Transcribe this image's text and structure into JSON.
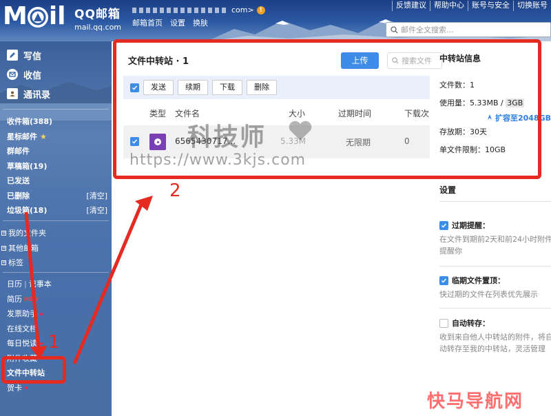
{
  "header": {
    "logo_main": "M",
    "logo_tail": "il",
    "logo_cn": "QQ邮箱",
    "logo_url": "mail.qq.com",
    "account_suffix": "com>",
    "warn_icon": "!",
    "nav": [
      "邮箱首页",
      "设置",
      "换肤"
    ],
    "top_links": [
      "反馈建议",
      "帮助中心",
      "账号与安全",
      "切换账号"
    ],
    "search_placeholder": "邮件全文搜索..."
  },
  "sidebar": {
    "quick": [
      {
        "label": "写信",
        "icon": "pen-icon"
      },
      {
        "label": "收信",
        "icon": "inbox-icon"
      },
      {
        "label": "通讯录",
        "icon": "contacts-icon"
      }
    ],
    "folders": [
      {
        "label": "收件箱(388)",
        "right": ""
      },
      {
        "label": "星标邮件",
        "right": "",
        "star": "★"
      },
      {
        "label": "群邮件",
        "right": ""
      },
      {
        "label": "草稿箱(19)",
        "right": ""
      },
      {
        "label": "已发送",
        "right": ""
      },
      {
        "label": "已删除",
        "right": "[清空]"
      },
      {
        "label": "垃圾箱(18)",
        "right": "[清空]"
      }
    ],
    "groups": [
      "我的文件夹",
      "其他邮箱",
      "标签"
    ],
    "apps": [
      {
        "label": "日历",
        "extra": "记事本"
      },
      {
        "label": "简历",
        "badge": "NEW"
      },
      {
        "label": "发票助手"
      },
      {
        "label": "在线文档"
      },
      {
        "label": "每日悦读"
      },
      {
        "label": "附件收藏"
      },
      {
        "label": "文件中转站"
      },
      {
        "label": "贺卡"
      }
    ]
  },
  "panel": {
    "title": "文件中转站 · 1",
    "upload_label": "上传",
    "search_placeholder": "搜索文件",
    "toolbar": [
      "发送",
      "续期",
      "下载",
      "删除"
    ],
    "columns": [
      "类型",
      "文件名",
      "大小",
      "过期时间",
      "下载次"
    ],
    "rows": [
      {
        "name": "6565430717…",
        "size": "5.33M",
        "expiry": "无限期",
        "downloads": "0"
      }
    ]
  },
  "info": {
    "title": "中转站信息",
    "count_label": "文件数：",
    "count_value": "1",
    "usage_label": "使用量：",
    "usage_value": "5.33MB / ",
    "usage_total": "3GB",
    "expand_label": "扩容至2048GB",
    "retention_label": "存放期：",
    "retention_value": "30天",
    "limit_label": "单文件限制：",
    "limit_value": "10GB"
  },
  "settings": {
    "title": "设置",
    "options": [
      {
        "label": "过期提醒：",
        "checked": true,
        "desc": [
          "在文件到期前2天和前24小时附件",
          "提醒你"
        ]
      },
      {
        "label": "临期文件置顶：",
        "checked": true,
        "desc": [
          "快过期的文件在列表优先展示"
        ]
      },
      {
        "label": "自动转存：",
        "checked": false,
        "desc": [
          "收到来自他人中转站的附件，将自",
          "动转存至我的中转站，灵活管理"
        ]
      }
    ]
  },
  "annotations": {
    "one": "1",
    "two": "2"
  },
  "watermarks": {
    "cn": "科技师",
    "url": "https://www.3kjs.com",
    "corner": "快马导航网"
  },
  "colors": {
    "accent": "#3d8ce8",
    "annotation": "#e52a22",
    "sidebar": "#4a6fa6",
    "file_icon": "#7b3fb4"
  }
}
